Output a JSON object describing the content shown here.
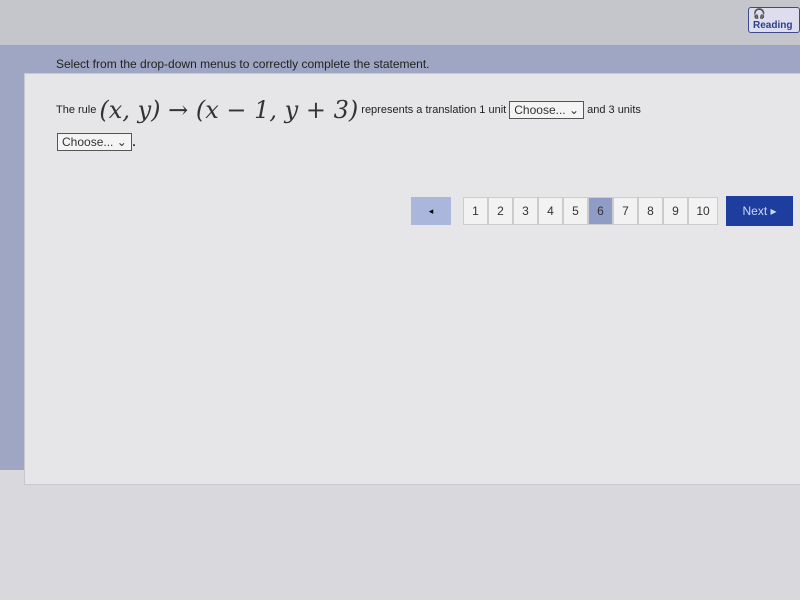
{
  "header": {
    "reading_label": "Reading"
  },
  "question": {
    "instruction": "Select from the drop-down menus to correctly complete the statement.",
    "rule_prefix": "The rule",
    "math": "(x, y) → (x − 1, y + 3)",
    "text_middle": "represents a translation 1 unit",
    "dropdown1": "Choose...",
    "text_end": "and 3 units",
    "dropdown2": "Choose...",
    "trailing": "."
  },
  "pager": {
    "prev": "◂",
    "pages": [
      "1",
      "2",
      "3",
      "4",
      "5",
      "6",
      "7",
      "8",
      "9",
      "10"
    ],
    "current": "6",
    "next": "Next ▸"
  }
}
